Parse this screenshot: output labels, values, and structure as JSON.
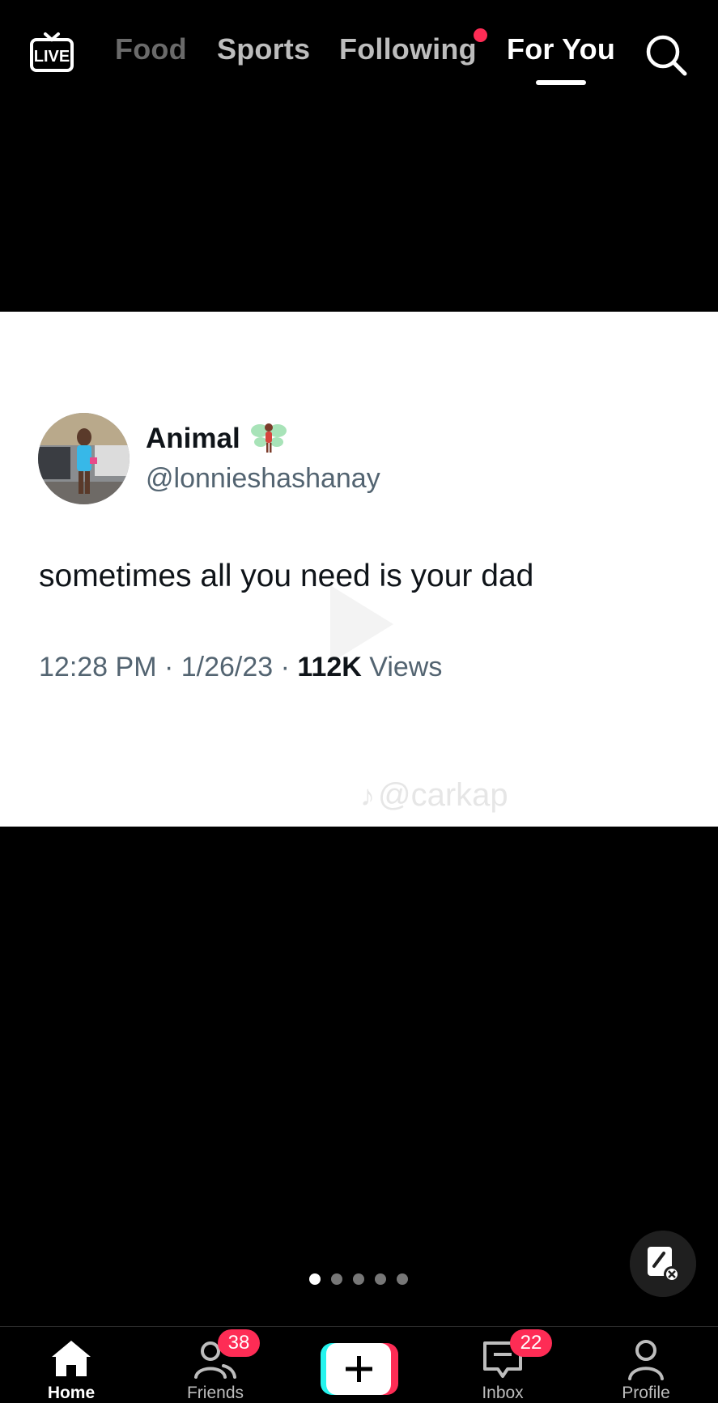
{
  "header": {
    "tabs": [
      {
        "label": "Food"
      },
      {
        "label": "Sports"
      },
      {
        "label": "Following"
      },
      {
        "label": "For You"
      }
    ],
    "live_label": "LIVE",
    "live_icon": "live-tv-icon",
    "search_icon": "search-icon"
  },
  "post": {
    "display_name": "Animal",
    "handle": "@lonnieshashanay",
    "text": "sometimes all you need is your dad",
    "time_date": "12:28 PM · 1/26/23 · ",
    "views_count": "112K",
    "views_label": " Views",
    "watermark": "@carkap"
  },
  "carousel": {
    "pages": 5,
    "active": 0
  },
  "bottom_nav": {
    "home": "Home",
    "friends": "Friends",
    "friends_badge": "38",
    "inbox": "Inbox",
    "inbox_badge": "22",
    "profile": "Profile"
  },
  "colors": {
    "accent": "#fe2c55",
    "cyan": "#25f4ee",
    "background": "#000000"
  }
}
